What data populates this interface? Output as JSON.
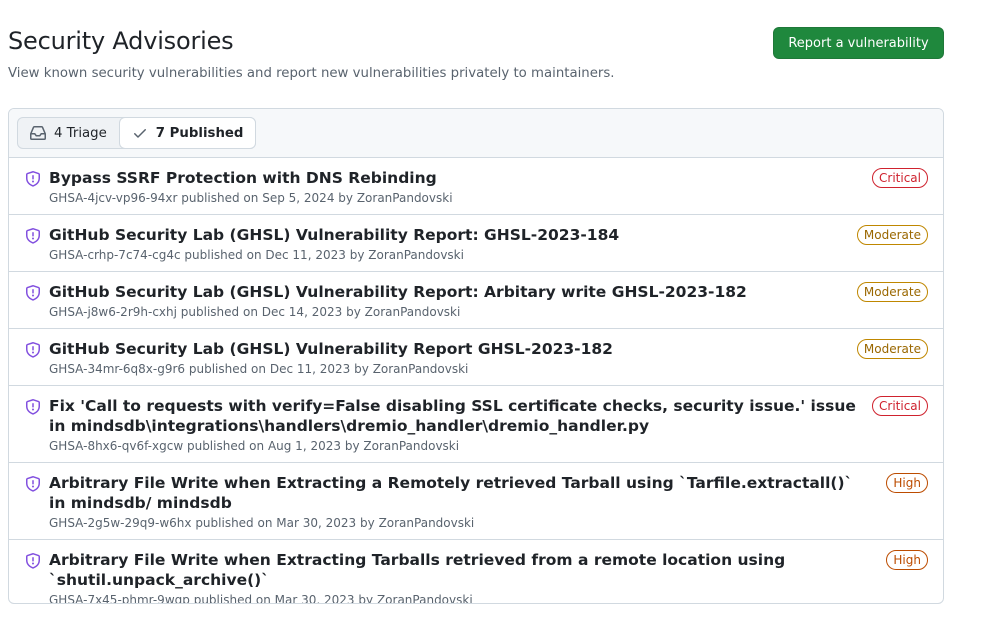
{
  "header": {
    "title": "Security Advisories",
    "subtitle": "View known security vulnerabilities and report new vulnerabilities privately to maintainers.",
    "report_button": "Report a vulnerability"
  },
  "filters": {
    "triage_label": "4 Triage",
    "published_label": "7 Published",
    "triage_icon": "inbox-icon",
    "published_icon": "check-icon"
  },
  "colors": {
    "critical": "#cf222e",
    "moderate": "#9a6700",
    "high": "#bc4c00",
    "primary_button": "#1f883d",
    "shield_icon": "#8250df"
  },
  "advisories": [
    {
      "title": "Bypass SSRF Protection with DNS Rebinding",
      "ghsa": "GHSA-4jcv-vp96-94xr",
      "published_text": "published on",
      "date": "Sep 5, 2024",
      "by_text": "by",
      "author": "ZoranPandovski",
      "severity": "Critical",
      "icon": "shield-icon"
    },
    {
      "title": "GitHub Security Lab (GHSL) Vulnerability Report: GHSL-2023-184",
      "ghsa": "GHSA-crhp-7c74-cg4c",
      "published_text": "published on",
      "date": "Dec 11, 2023",
      "by_text": "by",
      "author": "ZoranPandovski",
      "severity": "Moderate",
      "icon": "shield-icon"
    },
    {
      "title": "GitHub Security Lab (GHSL) Vulnerability Report: Arbitary write GHSL-2023-182",
      "ghsa": "GHSA-j8w6-2r9h-cxhj",
      "published_text": "published on",
      "date": "Dec 14, 2023",
      "by_text": "by",
      "author": "ZoranPandovski",
      "severity": "Moderate",
      "icon": "shield-icon"
    },
    {
      "title": "GitHub Security Lab (GHSL) Vulnerability Report GHSL-2023-182",
      "ghsa": "GHSA-34mr-6q8x-g9r6",
      "published_text": "published on",
      "date": "Dec 11, 2023",
      "by_text": "by",
      "author": "ZoranPandovski",
      "severity": "Moderate",
      "icon": "shield-icon"
    },
    {
      "title": "Fix 'Call to requests with verify=False disabling SSL certificate checks, security issue.' issue in mindsdb\\integrations\\handlers\\dremio_handler\\dremio_handler.py",
      "ghsa": "GHSA-8hx6-qv6f-xgcw",
      "published_text": "published on",
      "date": "Aug 1, 2023",
      "by_text": "by",
      "author": "ZoranPandovski",
      "severity": "Critical",
      "icon": "shield-icon"
    },
    {
      "title": "Arbitrary File Write when Extracting a Remotely retrieved Tarball using `Tarfile.extractall()` in mindsdb/ mindsdb",
      "ghsa": "GHSA-2g5w-29q9-w6hx",
      "published_text": "published on",
      "date": "Mar 30, 2023",
      "by_text": "by",
      "author": "ZoranPandovski",
      "severity": "High",
      "icon": "shield-icon"
    },
    {
      "title": "Arbitrary File Write when Extracting Tarballs retrieved from a remote location using `shutil.unpack_archive()`",
      "ghsa": "GHSA-7x45-phmr-9wqp",
      "published_text": "published on",
      "date": "Mar 30, 2023",
      "by_text": "by",
      "author": "ZoranPandovski",
      "severity": "High",
      "icon": "shield-icon"
    }
  ]
}
